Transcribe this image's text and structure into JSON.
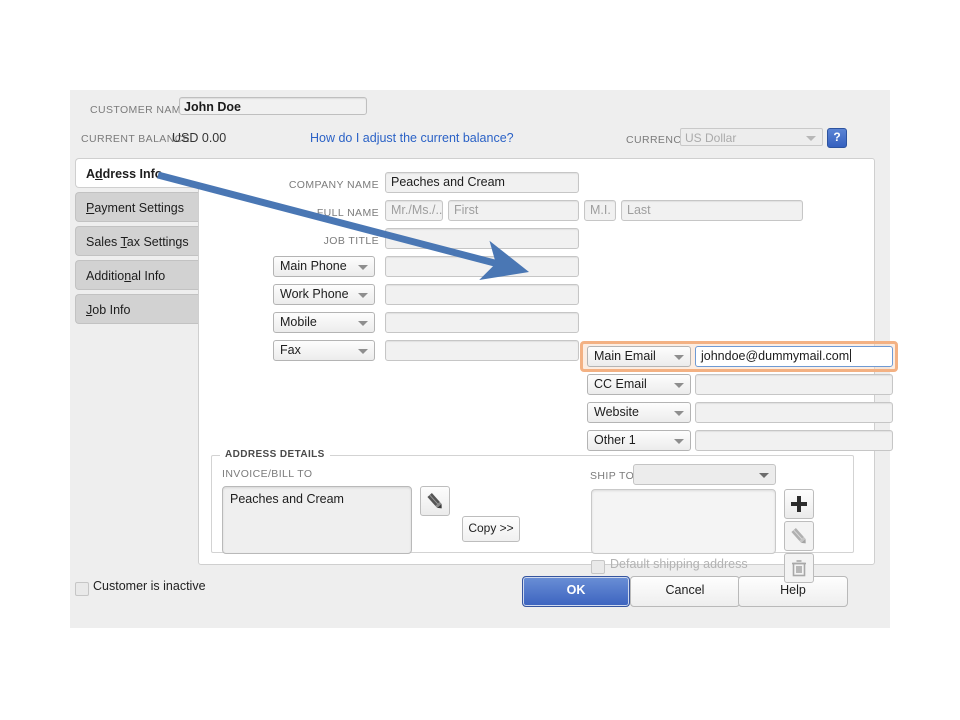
{
  "header": {
    "customer_name_label": "CUSTOMER NAME",
    "customer_name_value": "John Doe",
    "current_balance_label": "CURRENT BALANCE",
    "current_balance_value": "USD 0.00",
    "balance_help_link": "How do I adjust the current balance?",
    "currency_label": "CURRENCY",
    "currency_value": "US Dollar",
    "help_button": "?"
  },
  "tabs": [
    {
      "label": "Address Info",
      "accel_index": 2,
      "active": true
    },
    {
      "label": "Payment Settings",
      "accel_index": 0,
      "active": false
    },
    {
      "label": "Sales Tax Settings",
      "accel_index": 6,
      "active": false
    },
    {
      "label": "Additional Info",
      "accel_index": 8,
      "active": false
    },
    {
      "label": "Job Info",
      "accel_index": 0,
      "active": false
    }
  ],
  "form": {
    "company_name_label": "COMPANY NAME",
    "company_name_value": "Peaches and Cream",
    "full_name_label": "FULL NAME",
    "salutation_placeholder": "Mr./Ms./..",
    "first_placeholder": "First",
    "mi_placeholder": "M.I.",
    "last_placeholder": "Last",
    "job_title_label": "JOB TITLE",
    "job_title_value": ""
  },
  "contact_rows": [
    {
      "type": "Main Phone",
      "value": ""
    },
    {
      "type": "Work Phone",
      "value": ""
    },
    {
      "type": "Mobile",
      "value": ""
    },
    {
      "type": "Fax",
      "value": ""
    }
  ],
  "contact_rows_right": [
    {
      "type": "Main Email",
      "value": "johndoe@dummymail.com",
      "focused": true
    },
    {
      "type": "CC Email",
      "value": "",
      "focused": false
    },
    {
      "type": "Website",
      "value": "",
      "focused": false
    },
    {
      "type": "Other 1",
      "value": "",
      "focused": false
    }
  ],
  "address_details": {
    "legend": "ADDRESS DETAILS",
    "invoice_bill_to_label": "INVOICE/BILL TO",
    "invoice_bill_to_value": "Peaches and Cream",
    "copy_button": "Copy >>",
    "ship_to_label": "SHIP TO",
    "ship_to_value": "",
    "ship_to_address_value": "",
    "default_shipping_label": "Default shipping address",
    "edit_icon": "pencil-icon",
    "add_icon": "plus-icon",
    "delete_icon": "trash-icon"
  },
  "footer": {
    "inactive_checkbox_label": "Customer is inactive",
    "ok_button": "OK",
    "cancel_button": "Cancel",
    "help_button": "Help"
  },
  "annotation": {
    "type": "arrow",
    "color": "#4a77b4",
    "from": "Address Info tab",
    "to": "Main Email field"
  },
  "colors": {
    "accent_blue": "#3c63bf",
    "link_blue": "#2b62c6",
    "highlight_orange": "#f3b183",
    "panel_gray": "#eeeeee"
  }
}
